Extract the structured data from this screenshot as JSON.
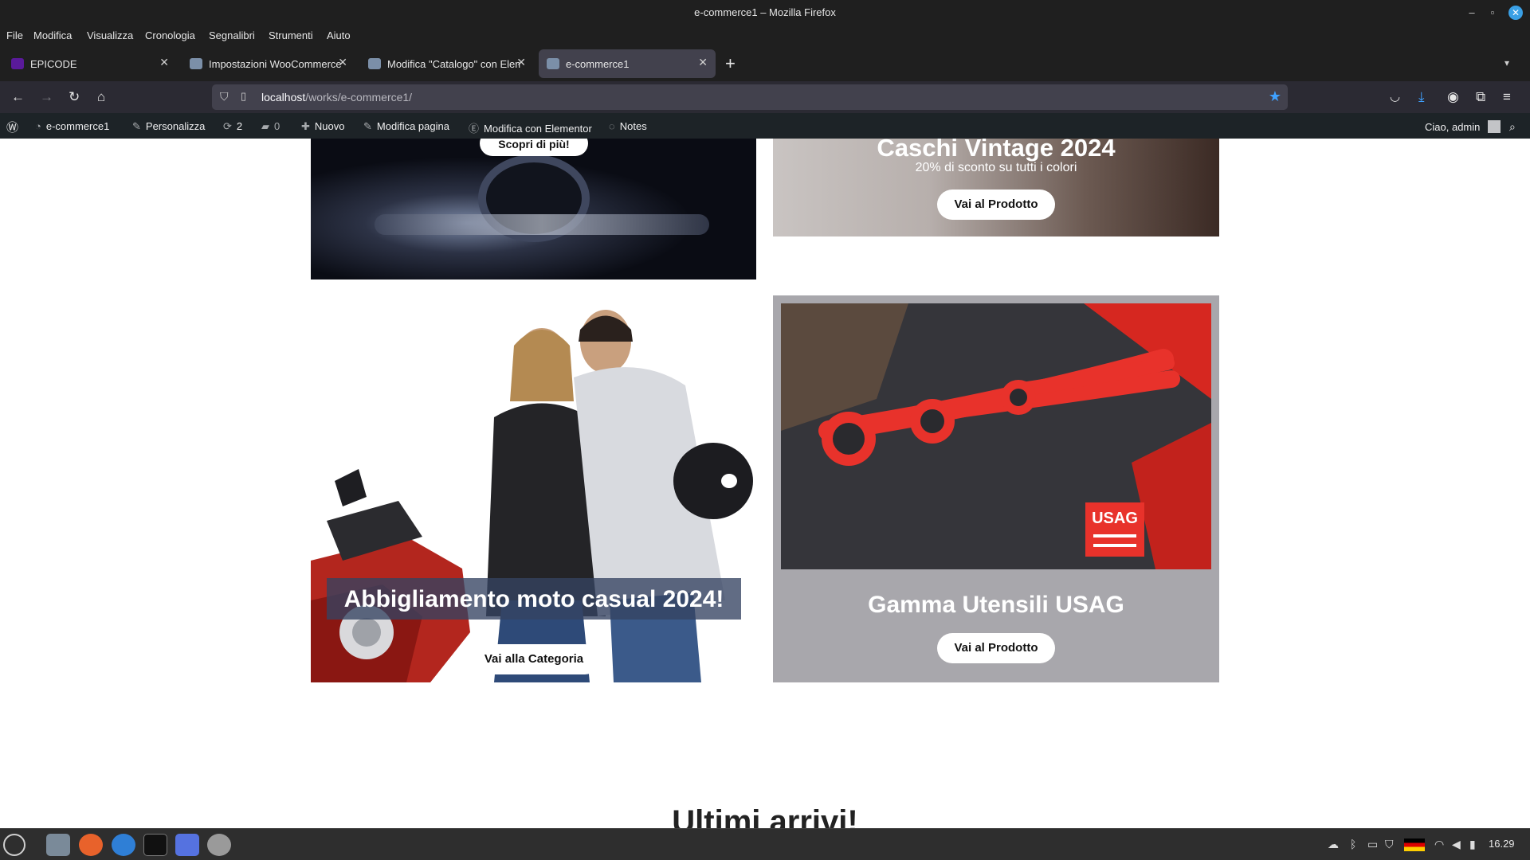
{
  "window": {
    "title": "e-commerce1 – Mozilla Firefox"
  },
  "menubar": {
    "items": [
      "File",
      "Modifica",
      "Visualizza",
      "Cronologia",
      "Segnalibri",
      "Strumenti",
      "Aiuto"
    ]
  },
  "tabs": [
    {
      "label": "EPICODE",
      "active": false
    },
    {
      "label": "Impostazioni WooCommerce",
      "active": false
    },
    {
      "label": "Modifica \"Catalogo\" con Elementor",
      "active": false
    },
    {
      "label": "e-commerce1",
      "active": true
    }
  ],
  "navbar": {
    "url_host": "localhost",
    "url_path": "/works/e-commerce1/"
  },
  "wpbar": {
    "site": "e-commerce1",
    "customize": "Personalizza",
    "updates": "2",
    "comments": "0",
    "new": "Nuovo",
    "edit_page": "Modifica pagina",
    "edit_elementor": "Modifica con Elementor",
    "notes": "Notes",
    "greeting": "Ciao, admin"
  },
  "content": {
    "moto_button": "Scopri di più!",
    "caschi": {
      "title": "Caschi Vintage 2024",
      "subtitle": "20% di sconto su tutti i colori",
      "button": "Vai al Prodotto"
    },
    "abbigliamento": {
      "title": "Abbigliamento moto casual 2024!",
      "button": "Vai alla Categoria"
    },
    "usag": {
      "title": "Gamma Utensili USAG",
      "button": "Vai al Prodotto",
      "logo_text": "USAG"
    },
    "latest_title": "Ultimi arrivi!"
  },
  "taskbar": {
    "clock": "16.29"
  },
  "colors": {
    "accent": "#3fa1ff",
    "wpbar": "#1d2327",
    "usag_card": "#a8a7ac",
    "tool_red": "#e8322b"
  }
}
